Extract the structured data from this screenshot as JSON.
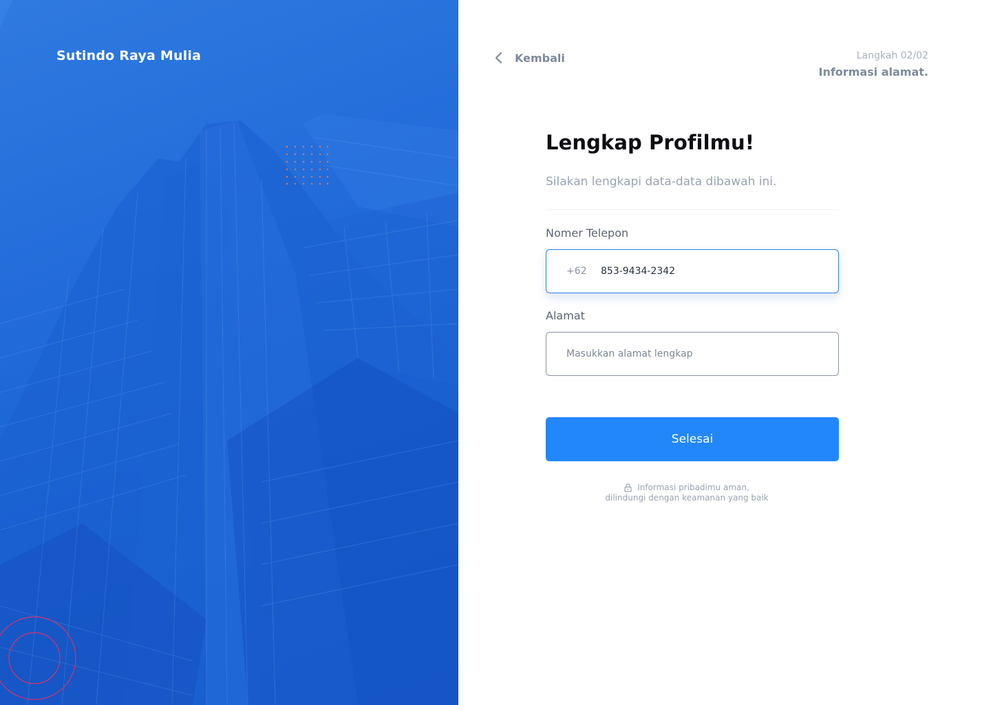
{
  "brand": {
    "name": "Sutindo Raya Mulia"
  },
  "nav": {
    "back_label": "Kembali"
  },
  "step": {
    "count": "Langkah 02/02",
    "title": "Informasi alamat."
  },
  "form": {
    "title": "Lengkap Profilmu!",
    "subtitle": "Silakan lengkapi data-data dibawah ini.",
    "phone": {
      "label": "Nomer Telepon",
      "prefix": "+62",
      "value": "853-9434-2342"
    },
    "address": {
      "label": "Alamat",
      "placeholder": "Masukkan alamat lengkap",
      "value": ""
    },
    "submit_label": "Selesai",
    "secure_line1": "Informasi pribadimu aman,",
    "secure_line2": "dilindungi dengan keamanan yang baik"
  },
  "colors": {
    "hero_blue": "#1f68d8",
    "accent": "#2287fb",
    "focus_border": "#2b7fe8",
    "muted_text": "#7d8a9c",
    "dot_accent": "#e8744a",
    "ring_accent": "#d6336c"
  },
  "icons": {
    "back": "chevron-left-icon",
    "secure": "lock-icon"
  }
}
